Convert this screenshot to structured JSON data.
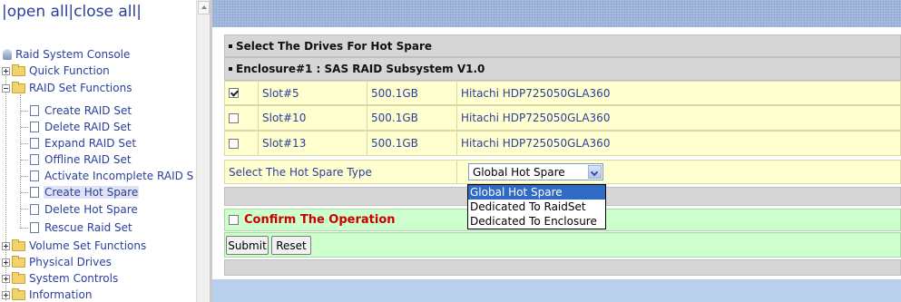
{
  "nav": {
    "top_links": "|open all|close all|",
    "console_label": "Raid System Console",
    "items": [
      {
        "label": "Quick Function"
      },
      {
        "label": "RAID Set Functions"
      },
      {
        "label": "Create RAID Set"
      },
      {
        "label": "Delete RAID Set"
      },
      {
        "label": "Expand RAID Set"
      },
      {
        "label": "Offline RAID Set"
      },
      {
        "label": "Activate Incomplete RAID S"
      },
      {
        "label": "Create Hot Spare"
      },
      {
        "label": "Delete Hot Spare"
      },
      {
        "label": "Rescue Raid Set"
      },
      {
        "label": "Volume Set Functions"
      },
      {
        "label": "Physical Drives"
      },
      {
        "label": "System Controls"
      },
      {
        "label": "Information"
      }
    ]
  },
  "main": {
    "section_title": "Select The Drives For Hot Spare",
    "enclosure_title": "Enclosure#1 : SAS RAID Subsystem V1.0",
    "drives": [
      {
        "checked": true,
        "slot": "Slot#5",
        "size": "500.1GB",
        "model": "Hitachi HDP725050GLA360"
      },
      {
        "checked": false,
        "slot": "Slot#10",
        "size": "500.1GB",
        "model": "Hitachi HDP725050GLA360"
      },
      {
        "checked": false,
        "slot": "Slot#13",
        "size": "500.1GB",
        "model": "Hitachi HDP725050GLA360"
      }
    ],
    "hot_spare_type_label": "Select The Hot Spare Type",
    "hot_spare_type_value": "Global Hot Spare",
    "hot_spare_options": [
      "Global Hot Spare",
      "Dedicated To RaidSet",
      "Dedicated To Enclosure"
    ],
    "confirm_label": "Confirm The Operation",
    "submit_label": "Submit",
    "reset_label": "Reset"
  },
  "colors": {
    "link_blue": "#2a3f9a",
    "drive_row_bg": "#ffffd0",
    "confirm_red": "#cc0000",
    "green_row_bg": "#ccffcc",
    "selected_option_bg": "#316ac5"
  }
}
